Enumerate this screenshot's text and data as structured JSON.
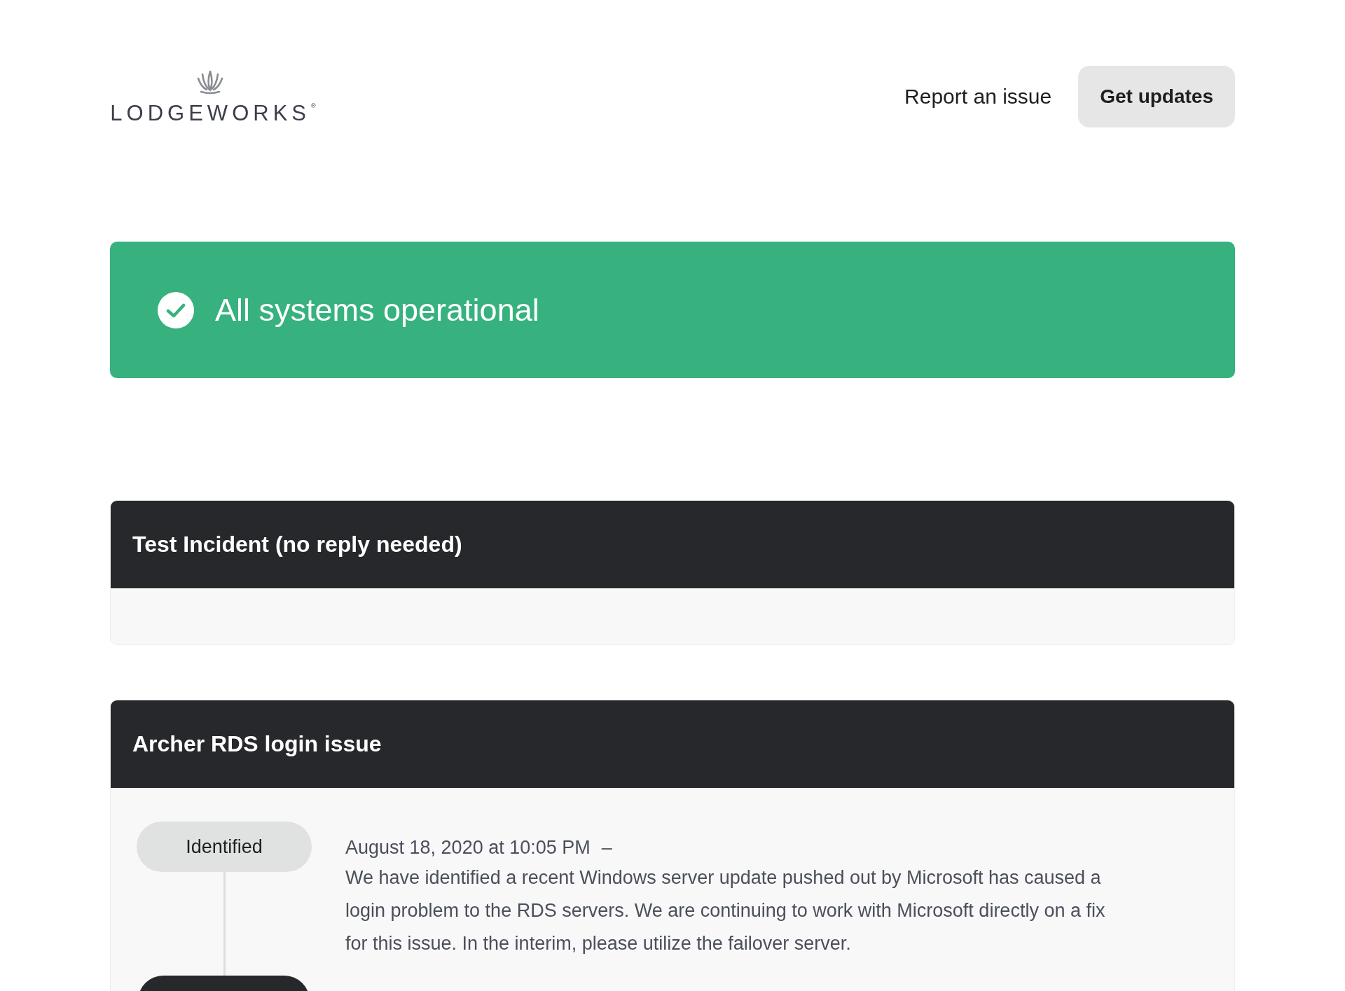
{
  "header": {
    "logo": {
      "wordmark": "LODGEWORKS",
      "mark": "®"
    },
    "links": [
      {
        "label": "Report an issue",
        "kind": "link"
      },
      {
        "label": "Get updates",
        "kind": "button"
      }
    ]
  },
  "status": {
    "text": "All systems operational",
    "operational": true
  },
  "incidents": [
    {
      "title": "Test Incident (no reply needed)"
    },
    {
      "title": "Archer RDS login issue",
      "updates": [
        {
          "status": "Identified",
          "time": "August 18, 2020 at 10:05 PM",
          "separator": "–",
          "body": "We have identified a recent Windows server update pushed out by Microsoft has caused a login problem to the RDS servers. We are continuing to work with Microsoft directly on a fix for this issue. In the interim, please utilize the failover server."
        }
      ],
      "more_updates_below": true
    }
  ]
}
